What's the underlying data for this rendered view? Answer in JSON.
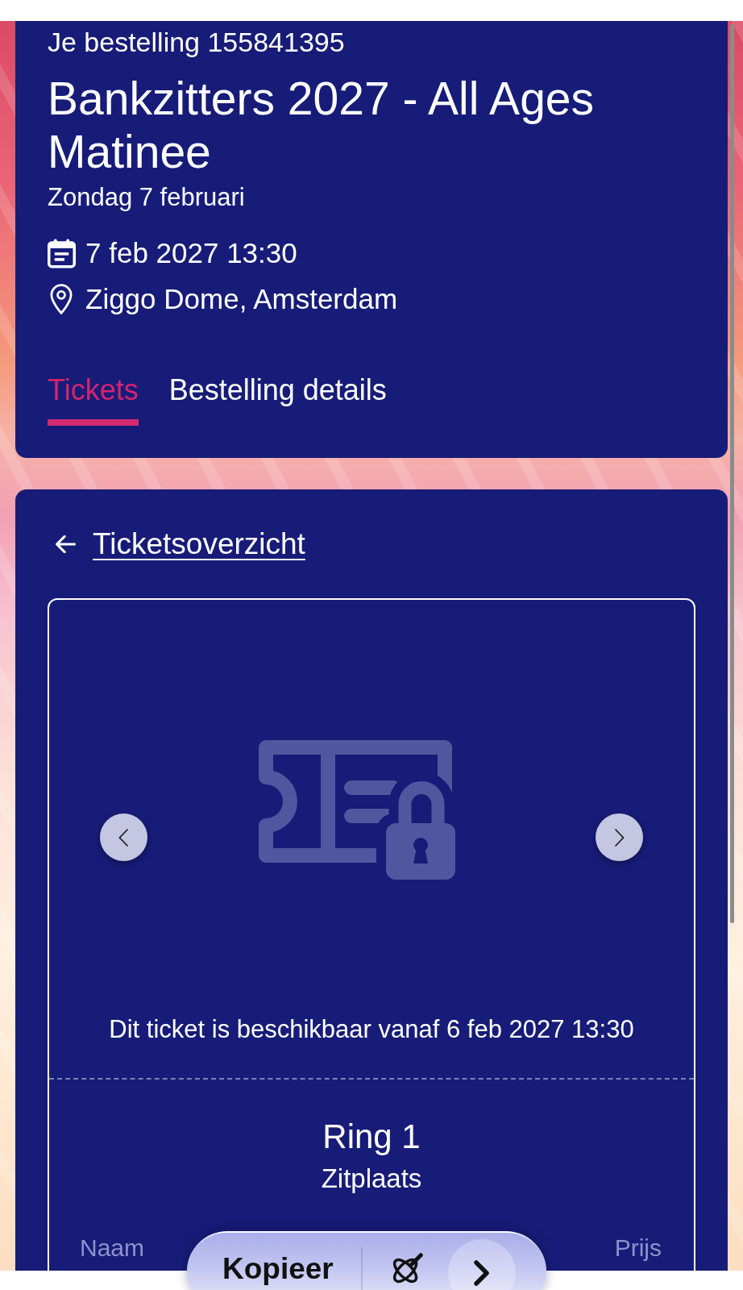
{
  "order": {
    "label": "Je bestelling 155841395",
    "title": "Bankzitters 2027 - All Ages Matinee",
    "day": "Zondag 7 februari",
    "datetime": "7 feb 2027 13:30",
    "venue": "Ziggo Dome, Amsterdam"
  },
  "tabs": [
    {
      "label": "Tickets",
      "selected": true
    },
    {
      "label": "Bestelling details",
      "selected": false
    }
  ],
  "ticket": {
    "back_link": "Ticketsoverzicht",
    "availability": "Dit ticket is beschikbaar vanaf 6 feb 2027 13:30",
    "section": "Ring 1",
    "seat_type": "Zitplaats",
    "columns": [
      "Naam",
      "Prijs"
    ]
  },
  "selection_toolbar": {
    "copy": "Kopieer"
  }
}
